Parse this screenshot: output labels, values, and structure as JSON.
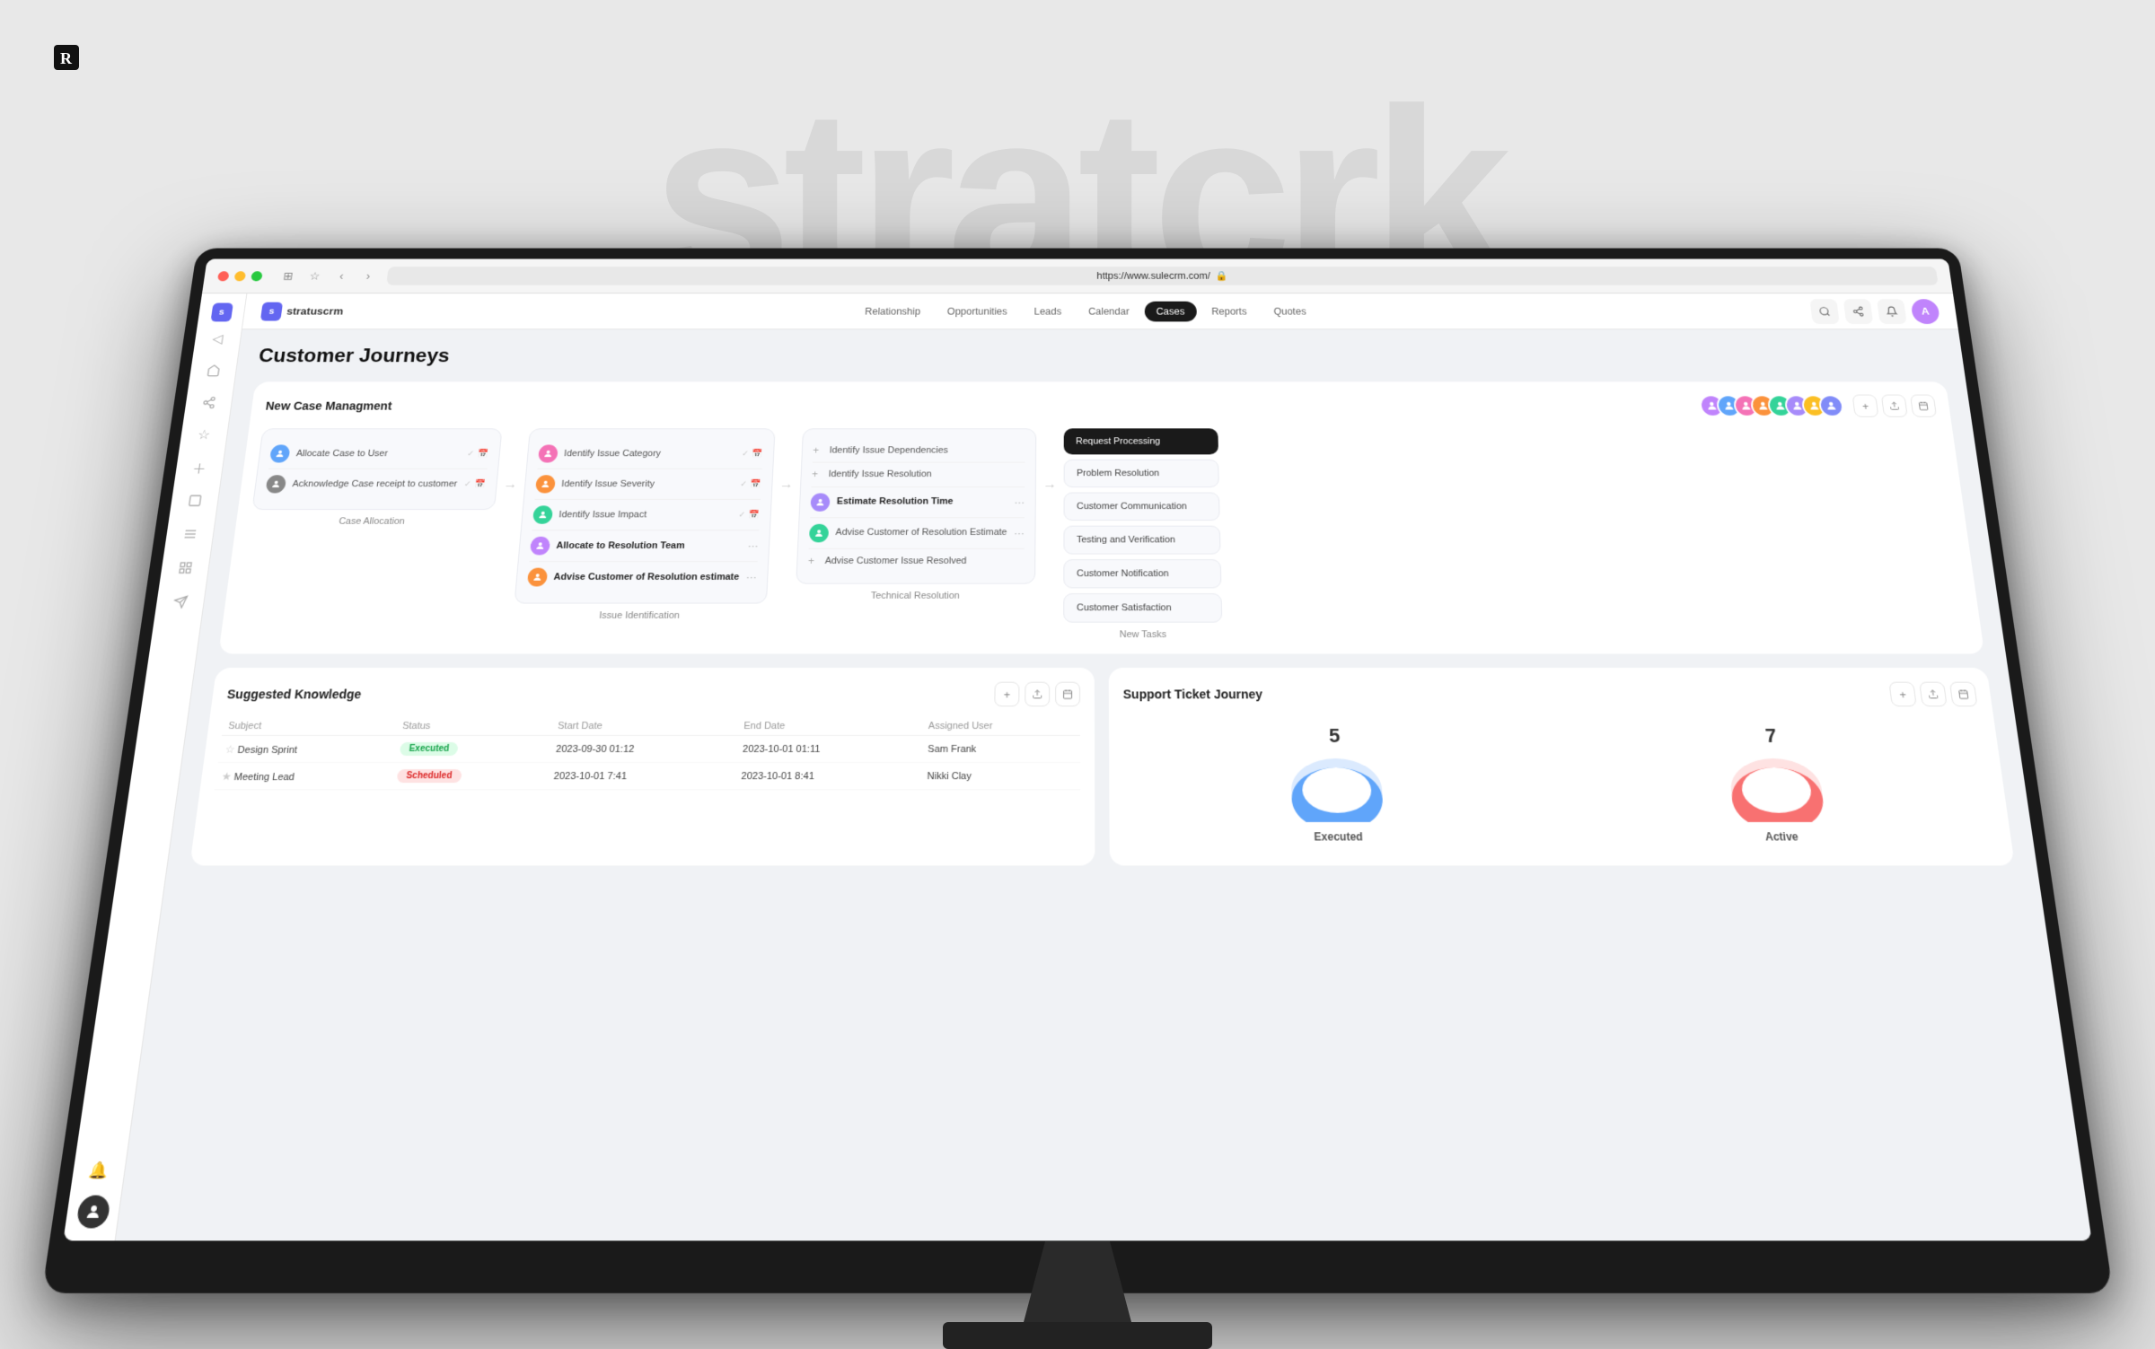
{
  "background_text": "stratcrk",
  "top_logo": "R",
  "browser": {
    "url": "https://www.sulecrm.com/",
    "back_btn": "‹",
    "forward_btn": "›"
  },
  "nav": {
    "brand": "stratuscrm",
    "links": [
      "Relationship",
      "Opportunities",
      "Leads",
      "Calendar",
      "Cases",
      "Reports",
      "Quotes"
    ],
    "active_link": "Cases"
  },
  "page": {
    "title": "Customer Journeys"
  },
  "journey_card": {
    "title": "New Case Managment",
    "add_btn": "+",
    "stages": [
      {
        "label": "Case Allocation",
        "tasks": [
          {
            "text": "Allocate Case to User",
            "has_check": true,
            "has_cal": true
          },
          {
            "text": "Acknowledge Case receipt to customer",
            "has_check": true,
            "has_cal": true
          }
        ]
      },
      {
        "label": "Issue Identification",
        "tasks": [
          {
            "text": "Identify Issue Category",
            "has_check": true,
            "has_cal": true
          },
          {
            "text": "Identify Issue Severity",
            "has_check": true,
            "has_cal": true
          },
          {
            "text": "Identify Issue Impact",
            "has_check": true,
            "has_cal": true
          },
          {
            "text": "Allocate to Resolution Team",
            "bold": true,
            "has_dots": true
          },
          {
            "text": "Advise Customer of Resolution estimate",
            "bold": true,
            "has_dots": true
          }
        ]
      },
      {
        "label": "Technical Resolution",
        "tasks": [
          {
            "text": "Identify Issue Dependencies",
            "has_plus": true
          },
          {
            "text": "Identify Issue Resolution",
            "has_plus": true
          },
          {
            "text": "Estimate Resolution Time",
            "bold": true,
            "has_dots": true
          },
          {
            "text": "Advise Customer of Resolution Estimate",
            "has_dots": true
          },
          {
            "text": "Advise Customer Issue Resolved",
            "has_plus": true
          }
        ]
      },
      {
        "label": "New Tasks",
        "items": [
          {
            "text": "Request Processing",
            "dark": true
          },
          {
            "text": "Problem Resolution"
          },
          {
            "text": "Customer Communication"
          },
          {
            "text": "Testing and Verification"
          },
          {
            "text": "Customer Notification"
          },
          {
            "text": "Customer Satisfaction"
          }
        ]
      }
    ]
  },
  "suggested_knowledge": {
    "title": "Suggested Knowledge",
    "columns": [
      "Subject",
      "Status",
      "Start Date",
      "End Date",
      "Assigned User"
    ],
    "rows": [
      {
        "subject": "Design Sprint",
        "status": "Executed",
        "status_type": "executed",
        "start_date": "2023-09-30 01:12",
        "end_date": "2023-10-01 01:11",
        "assigned_user": "Sam Frank"
      },
      {
        "subject": "Meeting Lead",
        "status": "Scheduled",
        "status_type": "scheduled",
        "start_date": "2023-10-01 7:41",
        "end_date": "2023-10-01 8:41",
        "assigned_user": "Nikki Clay"
      }
    ]
  },
  "support_ticket": {
    "title": "Support Ticket Journey",
    "chart1": {
      "number": "5",
      "label": "Executed",
      "color": "#60a5fa"
    },
    "chart2": {
      "number": "7",
      "label": "Active",
      "color": "#f87171"
    }
  },
  "sidebar_items": [
    {
      "icon": "◁",
      "name": "collapse"
    },
    {
      "icon": "⬡",
      "name": "home"
    },
    {
      "icon": "♡",
      "name": "favorites"
    },
    {
      "icon": "☆",
      "name": "starred"
    },
    {
      "icon": "＋",
      "name": "add"
    },
    {
      "icon": "◻",
      "name": "pages"
    },
    {
      "icon": "☰",
      "name": "menu"
    },
    {
      "icon": "◫",
      "name": "grid"
    },
    {
      "icon": "✈",
      "name": "send"
    },
    {
      "icon": "🔔",
      "name": "notifications"
    }
  ],
  "avatars": [
    "#c084fc",
    "#60a5fa",
    "#34d399",
    "#fb923c",
    "#f472b6",
    "#2dd4bf",
    "#a78bfa",
    "#fbbf24",
    "#818cf8"
  ]
}
